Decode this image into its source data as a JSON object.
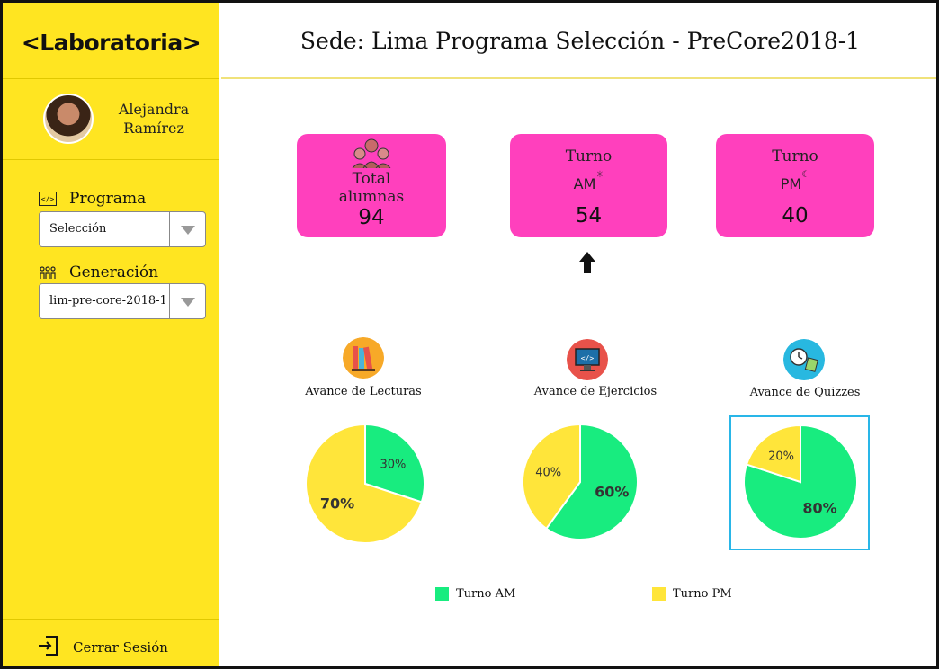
{
  "sidebar": {
    "logo": "<Laboratoria>",
    "user_name": "Alejandra Ramírez",
    "programa_label": "Programa",
    "programa_value": "Selección",
    "generacion_label": "Generación",
    "generacion_value": "lim-pre-core-2018-1",
    "logout_label": "Cerrar Sesión"
  },
  "header": {
    "title": "Sede: Lima  Programa Selección - PreCore2018-1"
  },
  "cards": {
    "total": {
      "label_line1": "Total",
      "label_line2": "alumnas",
      "value": "94"
    },
    "am": {
      "label": "Turno",
      "sub": "AM",
      "value": "54"
    },
    "pm": {
      "label": "Turno",
      "sub": "PM",
      "value": "40"
    }
  },
  "charts_labels": {
    "lecturas": "Avance de Lecturas",
    "ejercicios": "Avance de Ejercicios",
    "quizzes": "Avance de Quizzes"
  },
  "legend": {
    "am": "Turno AM",
    "pm": "Turno PM"
  },
  "colors": {
    "sidebar": "#ffe521",
    "card": "#ff40bd",
    "am": "#18ec7f",
    "pm": "#ffe53a",
    "focus": "#29b6e8"
  },
  "chart_data": [
    {
      "type": "pie",
      "title": "Avance de Lecturas",
      "labels": [
        "Turno AM",
        "Turno PM"
      ],
      "values": [
        30,
        70
      ],
      "value_labels": [
        "30%",
        "70%"
      ]
    },
    {
      "type": "pie",
      "title": "Avance de Ejercicios",
      "labels": [
        "Turno AM",
        "Turno PM"
      ],
      "values": [
        60,
        40
      ],
      "value_labels": [
        "60%",
        "40%"
      ]
    },
    {
      "type": "pie",
      "title": "Avance de Quizzes",
      "labels": [
        "Turno AM",
        "Turno PM"
      ],
      "values": [
        80,
        20
      ],
      "value_labels": [
        "80%",
        "20%"
      ]
    }
  ]
}
